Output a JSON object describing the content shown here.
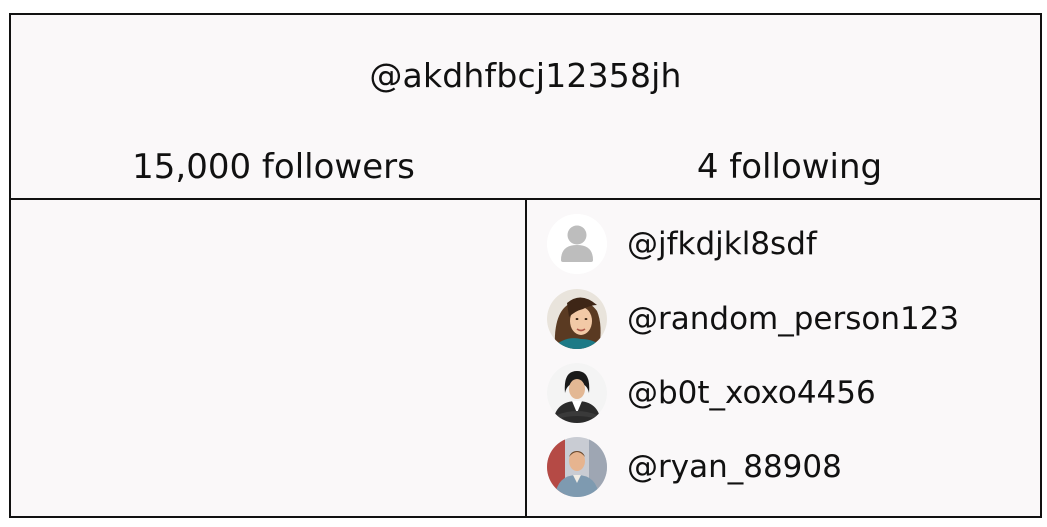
{
  "profile": {
    "handle": "@akdhfbcj12358jh",
    "followers_label": "15,000 followers",
    "following_label": "4 following"
  },
  "following": [
    {
      "username": "@jfkdjkl8sdf",
      "avatar": "default-avatar-icon"
    },
    {
      "username": "@random_person123",
      "avatar": "woman-photo-avatar"
    },
    {
      "username": "@b0t_xoxo4456",
      "avatar": "businesswoman-photo-avatar"
    },
    {
      "username": "@ryan_88908",
      "avatar": "man-photo-avatar"
    }
  ],
  "colors": {
    "background": "#faf8f9",
    "border": "#111111",
    "default_avatar": "#bdbdbd"
  }
}
